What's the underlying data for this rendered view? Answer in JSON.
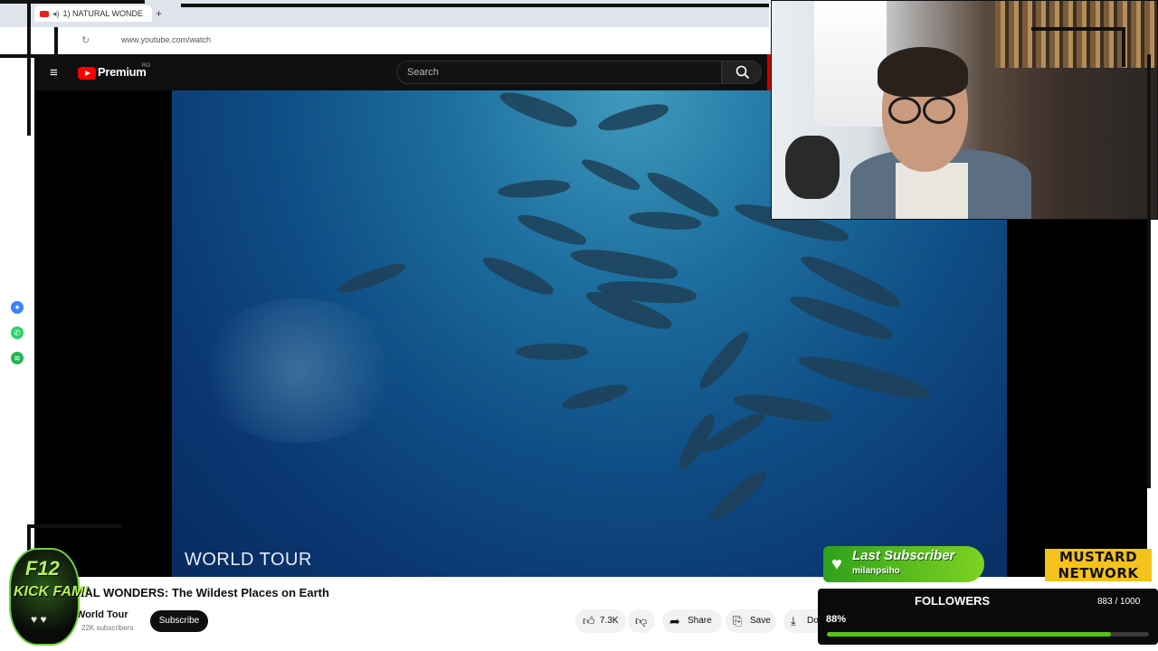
{
  "browser": {
    "tab_title": "1) NATURAL WONDE",
    "new_tab_symbol": "+",
    "url": "www.youtube.com/watch"
  },
  "youtube": {
    "logo_text": "Premium",
    "region": "RO",
    "search_placeholder": "Search",
    "video": {
      "overlay_text": "WORLD TOUR",
      "title": "RAL WONDERS: The Wildest Places on Earth",
      "channel": "World Tour",
      "subscribers": "22K subscribers",
      "subscribe_label": "Subscribe",
      "likes": "7.3K",
      "share_label": "Share",
      "save_label": "Save",
      "download_label": "Do"
    }
  },
  "overlay": {
    "last_subscriber_label": "Last Subscriber",
    "last_subscriber_name": "milanpsiho",
    "brand_line1": "MUSTARD",
    "brand_line2": "NETWORK",
    "followers_label": "FOLLOWERS",
    "followers_count": "883 / 1000",
    "followers_percent_text": "88%",
    "followers_fraction": 0.883,
    "badge_line1": "F12",
    "badge_line2": "KICK FAM!",
    "badge_hearts": "♥ ♥"
  },
  "colors": {
    "yt_red": "#ff0000",
    "progress_green": "#52c41a",
    "mustard": "#f4c21b",
    "subscriber_green": "#7ed321"
  }
}
